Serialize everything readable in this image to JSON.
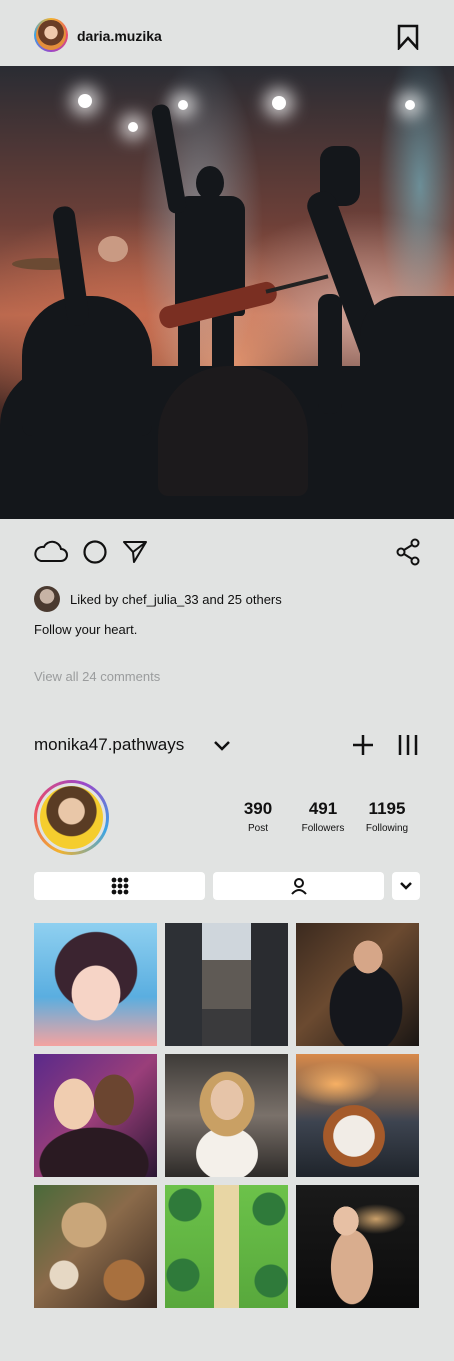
{
  "post": {
    "username": "daria.muzika",
    "liked_by": "Liked by chef_julia_33 and 25 others",
    "caption": "Follow your heart.",
    "view_comments": "View all 24 comments"
  },
  "profile": {
    "username": "monika47.pathways",
    "stats": [
      {
        "value": "390",
        "label": "Post"
      },
      {
        "value": "491",
        "label": "Followers"
      },
      {
        "value": "1195",
        "label": "Following"
      }
    ]
  },
  "icons": {
    "bookmark": "bookmark-icon",
    "like": "cloud-icon",
    "comment": "circle-icon",
    "send": "send-icon",
    "share": "share-icon",
    "add": "plus-icon",
    "menu": "bars-icon",
    "grid": "grid-icon",
    "tagged": "person-icon",
    "more": "chevron-down-icon"
  },
  "colors": {
    "background": "#e1e3e2",
    "muted_text": "#9a9c9d"
  }
}
